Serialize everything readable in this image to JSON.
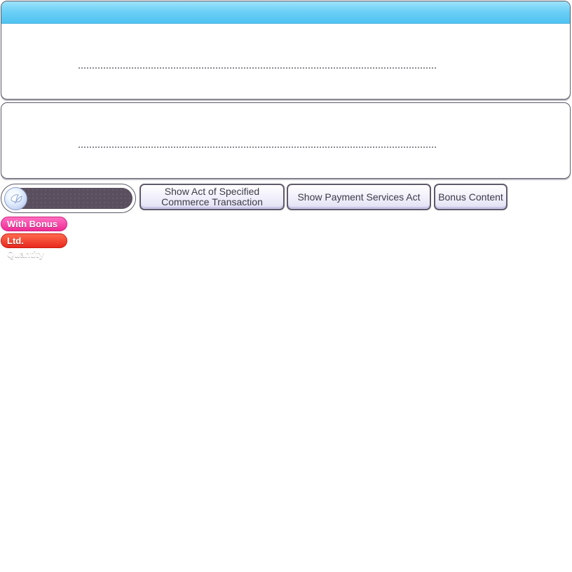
{
  "panels": [
    {
      "header_color": "#5ccaf3"
    },
    {}
  ],
  "currency": {
    "icon": "gem-icon",
    "bar_color": "#5a4f5e"
  },
  "buttons": {
    "commerce_act": "Show Act of Specified\nCommerce Transaction",
    "payment_act": "Show Payment Services Act",
    "bonus_content": "Bonus Content"
  },
  "badges": {
    "with_bonus": "With Bonus",
    "with_bonus_color": "#f02a95",
    "limited_quantity": "Ltd. Quantity",
    "limited_quantity_color": "#e8281e"
  }
}
